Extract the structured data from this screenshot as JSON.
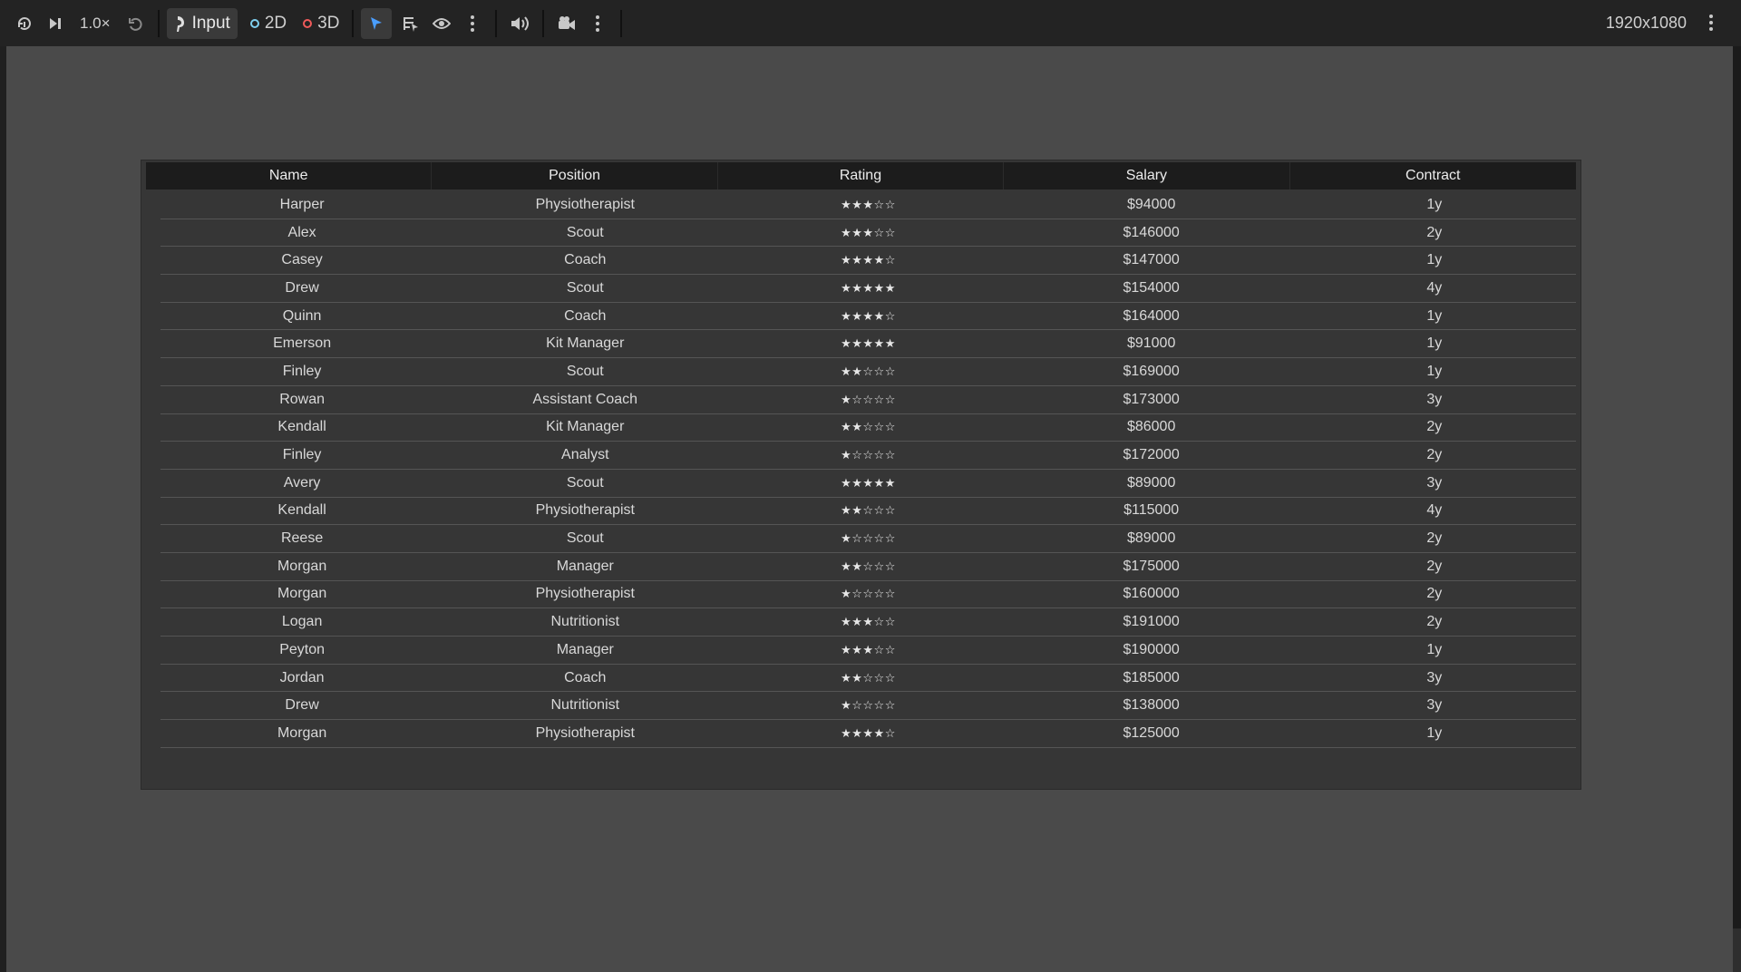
{
  "toolbar": {
    "speed": "1.0×",
    "input_label": "Input",
    "mode_2d": "2D",
    "mode_3d": "3D",
    "resolution": "1920x1080",
    "icons": [
      "refresh-icon",
      "step-icon",
      "undo-icon",
      "input-icon",
      "select-icon",
      "list-select-icon",
      "eye-icon",
      "more-icon",
      "audio-icon",
      "camera-icon",
      "more-icon"
    ]
  },
  "table": {
    "headers": [
      "Name",
      "Position",
      "Rating",
      "Salary",
      "Contract"
    ],
    "rows": [
      [
        "Harper",
        "Physiotherapist",
        "★★★☆☆",
        "$94000",
        "1y"
      ],
      [
        "Alex",
        "Scout",
        "★★★☆☆",
        "$146000",
        "2y"
      ],
      [
        "Casey",
        "Coach",
        "★★★★☆",
        "$147000",
        "1y"
      ],
      [
        "Drew",
        "Scout",
        "★★★★★",
        "$154000",
        "4y"
      ],
      [
        "Quinn",
        "Coach",
        "★★★★☆",
        "$164000",
        "1y"
      ],
      [
        "Emerson",
        "Kit Manager",
        "★★★★★",
        "$91000",
        "1y"
      ],
      [
        "Finley",
        "Scout",
        "★★☆☆☆",
        "$169000",
        "1y"
      ],
      [
        "Rowan",
        "Assistant Coach",
        "★☆☆☆☆",
        "$173000",
        "3y"
      ],
      [
        "Kendall",
        "Kit Manager",
        "★★☆☆☆",
        "$86000",
        "2y"
      ],
      [
        "Finley",
        "Analyst",
        "★☆☆☆☆",
        "$172000",
        "2y"
      ],
      [
        "Avery",
        "Scout",
        "★★★★★",
        "$89000",
        "3y"
      ],
      [
        "Kendall",
        "Physiotherapist",
        "★★☆☆☆",
        "$115000",
        "4y"
      ],
      [
        "Reese",
        "Scout",
        "★☆☆☆☆",
        "$89000",
        "2y"
      ],
      [
        "Morgan",
        "Manager",
        "★★☆☆☆",
        "$175000",
        "2y"
      ],
      [
        "Morgan",
        "Physiotherapist",
        "★☆☆☆☆",
        "$160000",
        "2y"
      ],
      [
        "Logan",
        "Nutritionist",
        "★★★☆☆",
        "$191000",
        "2y"
      ],
      [
        "Peyton",
        "Manager",
        "★★★☆☆",
        "$190000",
        "1y"
      ],
      [
        "Jordan",
        "Coach",
        "★★☆☆☆",
        "$185000",
        "3y"
      ],
      [
        "Drew",
        "Nutritionist",
        "★☆☆☆☆",
        "$138000",
        "3y"
      ],
      [
        "Morgan",
        "Physiotherapist",
        "★★★★☆",
        "$125000",
        "1y"
      ]
    ]
  },
  "colors": {
    "toolbar_bg": "#232323",
    "viewport_bg": "#4a4a4a",
    "panel_bg": "#363636",
    "header_bg": "#1c1c1c",
    "accent_select": "#4a9eff",
    "ring_2d": "#7fd0f0",
    "ring_3d": "#f05a5a"
  }
}
